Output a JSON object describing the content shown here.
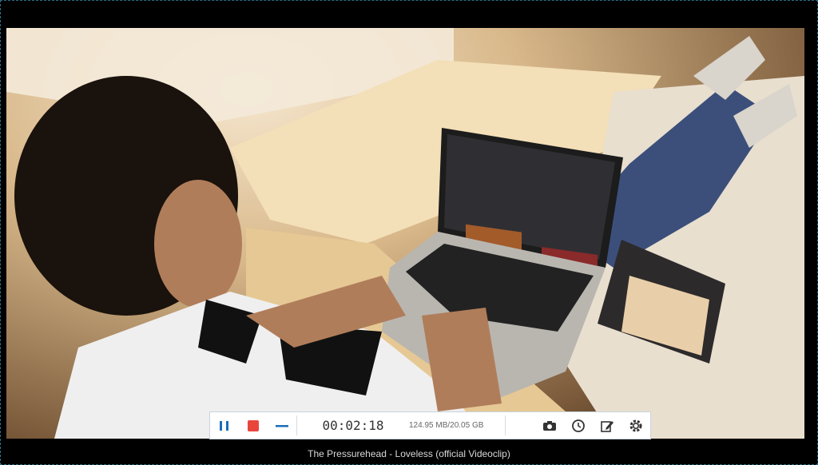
{
  "video": {
    "title": "The Pressurehead - Loveless (official Videoclip)"
  },
  "recorder": {
    "elapsed_time": "00:02:18",
    "file_size": "124.95 MB/20.05 GB",
    "pause_icon": "pause-icon",
    "stop_icon": "stop-icon",
    "minimize_icon": "minimize-icon",
    "screenshot_icon": "camera-icon",
    "schedule_icon": "clock-icon",
    "edit_icon": "edit-icon",
    "settings_icon": "gear-icon",
    "accent_color": "#1a6fb8",
    "stop_color": "#e8453c"
  }
}
